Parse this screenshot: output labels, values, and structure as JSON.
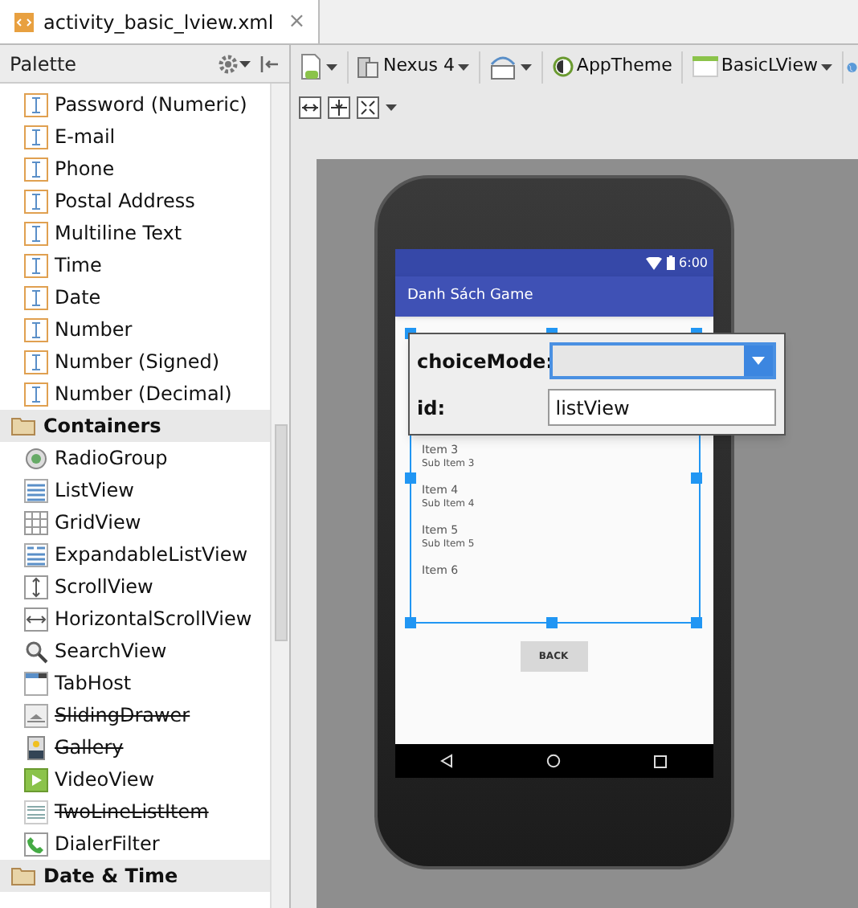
{
  "tab": {
    "title": "activity_basic_lview.xml",
    "close": "×"
  },
  "palette": {
    "title": "Palette",
    "sections": [
      {
        "kind": "items",
        "items": [
          {
            "label": "Password (Numeric)",
            "deprecated": false
          },
          {
            "label": "E-mail",
            "deprecated": false
          },
          {
            "label": "Phone",
            "deprecated": false
          },
          {
            "label": "Postal Address",
            "deprecated": false
          },
          {
            "label": "Multiline Text",
            "deprecated": false
          },
          {
            "label": "Time",
            "deprecated": false
          },
          {
            "label": "Date",
            "deprecated": false
          },
          {
            "label": "Number",
            "deprecated": false
          },
          {
            "label": "Number (Signed)",
            "deprecated": false
          },
          {
            "label": "Number (Decimal)",
            "deprecated": false
          }
        ]
      },
      {
        "kind": "header",
        "title": "Containers",
        "items": [
          {
            "label": "RadioGroup",
            "deprecated": false
          },
          {
            "label": "ListView",
            "deprecated": false
          },
          {
            "label": "GridView",
            "deprecated": false
          },
          {
            "label": "ExpandableListView",
            "deprecated": false
          },
          {
            "label": "ScrollView",
            "deprecated": false
          },
          {
            "label": "HorizontalScrollView",
            "deprecated": false
          },
          {
            "label": "SearchView",
            "deprecated": false
          },
          {
            "label": "TabHost",
            "deprecated": false
          },
          {
            "label": "SlidingDrawer",
            "deprecated": true
          },
          {
            "label": "Gallery",
            "deprecated": true
          },
          {
            "label": "VideoView",
            "deprecated": false
          },
          {
            "label": "TwoLineListItem",
            "deprecated": true
          },
          {
            "label": "DialerFilter",
            "deprecated": false
          }
        ]
      },
      {
        "kind": "header",
        "title": "Date & Time"
      }
    ]
  },
  "toolbar": {
    "device": "Nexus 4",
    "theme": "AppTheme",
    "activity": "BasicLView"
  },
  "phone": {
    "time": "6:00",
    "app_title": "Danh Sách Game",
    "list": [
      {
        "title": "Item 3",
        "subtitle": "Sub Item 3"
      },
      {
        "title": "Item 4",
        "subtitle": "Sub Item 4"
      },
      {
        "title": "Item 5",
        "subtitle": "Sub Item 5"
      },
      {
        "title": "Item 6"
      }
    ],
    "button": "BACK"
  },
  "popup": {
    "choice_label": "choiceMode:",
    "id_label": "id:",
    "id_value": "listView"
  }
}
